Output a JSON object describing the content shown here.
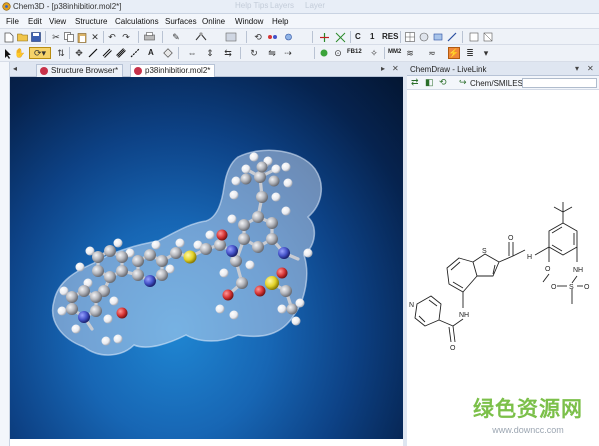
{
  "window": {
    "title": "Chem3D - [p38inhibitior.mol2*]",
    "faded_titles": [
      "Help Tips",
      "Layers",
      "Layer"
    ]
  },
  "menubar": [
    "File",
    "Edit",
    "View",
    "Structure",
    "Calculations",
    "Surfaces",
    "Online",
    "Window",
    "Help"
  ],
  "toolbar1": {
    "icons": [
      "new-file-icon",
      "open-folder-icon",
      "save-icon",
      "cut-icon",
      "copy-icon",
      "paste-icon",
      "clear-icon",
      "undo-icon",
      "redo-icon",
      "print-icon",
      "pencil-icon",
      "model-display-icon",
      "color-icon",
      "rotate-icon",
      "axes-icon",
      "bond-icon"
    ],
    "labels": {
      "carbon": "C",
      "one": "1",
      "res": "RES"
    }
  },
  "toolbar2": {
    "labels": {
      "a": "A",
      "fb": "FB12",
      "mm": "MM2"
    }
  },
  "tabs": [
    {
      "label": "Structure Browser*",
      "active": false
    },
    {
      "label": "p38inhibitior.mol2*",
      "active": true
    }
  ],
  "right_panel": {
    "title": "ChemDraw - LiveLink",
    "smiles_label": "Chem/SMILES:",
    "smiles_value": ""
  },
  "structure_labels": {
    "sulfur": "S",
    "amide1_o": "O",
    "amide1_nh": "H",
    "methoxy_o": "O",
    "nh_bottom": "NH",
    "sulfonyl": "S",
    "so_o_left": "O",
    "so_o_right": "O",
    "sulfonamide_n": "N",
    "sulfonamide_h": "H",
    "indole_nh": "NH",
    "pyridine_n": "N",
    "amide2_o": "O"
  },
  "watermark": {
    "chinese": "绿色资源网",
    "url": "www.downcc.com"
  },
  "colors": {
    "viewport_blue": "#1766b4",
    "carbon_grey": "#b5b7bd",
    "hydrogen_white": "#ffffff",
    "nitrogen_blue": "#4452c8",
    "oxygen_red": "#d63535",
    "sulfur_yellow": "#e3d228",
    "watermark_green": "#7cc04a"
  }
}
